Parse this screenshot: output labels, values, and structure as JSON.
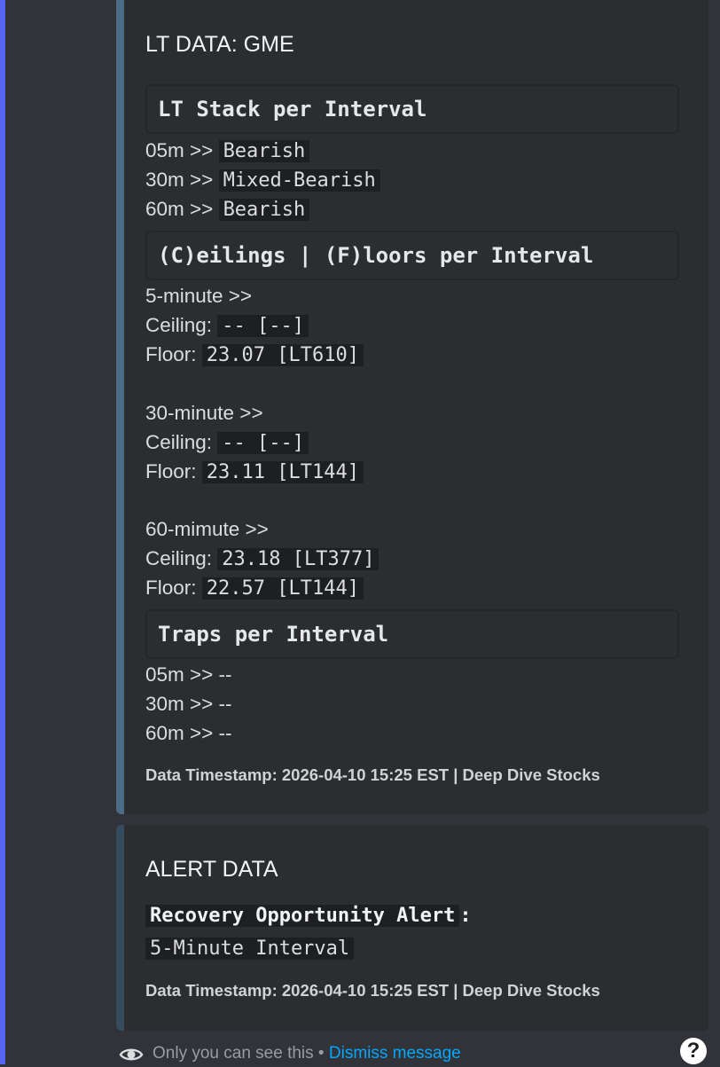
{
  "embed1": {
    "title": "LT DATA: GME",
    "stack_field": {
      "name": "LT Stack per Interval",
      "rows": [
        {
          "label": "05m >> ",
          "value": "Bearish"
        },
        {
          "label": "30m >> ",
          "value": "Mixed-Bearish"
        },
        {
          "label": "60m >> ",
          "value": "Bearish"
        }
      ]
    },
    "levels_field": {
      "name": "(C)eilings | (F)loors per Interval",
      "groups": [
        {
          "header": "5-minute >>",
          "ceiling_label": "Ceiling: ",
          "ceiling": "-- [--]",
          "floor_label": "Floor: ",
          "floor": "23.07 [LT610]"
        },
        {
          "header": "30-minute >>",
          "ceiling_label": "Ceiling: ",
          "ceiling": "-- [--]",
          "floor_label": "Floor: ",
          "floor": "23.11 [LT144]"
        },
        {
          "header": "60-mimute >>",
          "ceiling_label": "Ceiling: ",
          "ceiling": "23.18 [LT377]",
          "floor_label": "Floor: ",
          "floor": "22.57 [LT144]"
        }
      ]
    },
    "traps_field": {
      "name": "Traps per Interval",
      "rows": [
        "05m >> --",
        "30m >> --",
        "60m >> --"
      ]
    },
    "footer": "Data Timestamp: 2026-04-10 15:25 EST | Deep Dive Stocks"
  },
  "embed2": {
    "title": "ALERT DATA",
    "alert_name": "Recovery Opportunity Alert",
    "alert_colon": ":",
    "alert_value": "5-Minute Interval",
    "footer": "Data Timestamp: 2026-04-10 15:25 EST | Deep Dive Stocks"
  },
  "bottom": {
    "ephemeral_text": "Only you can see this • ",
    "dismiss_label": "Dismiss message",
    "help_label": "?"
  },
  "colors": {
    "accent": "#5865f2",
    "embed_border": "#4b6c86",
    "link": "#00a8fc"
  },
  "icons": [
    "eye-icon",
    "help-icon"
  ]
}
